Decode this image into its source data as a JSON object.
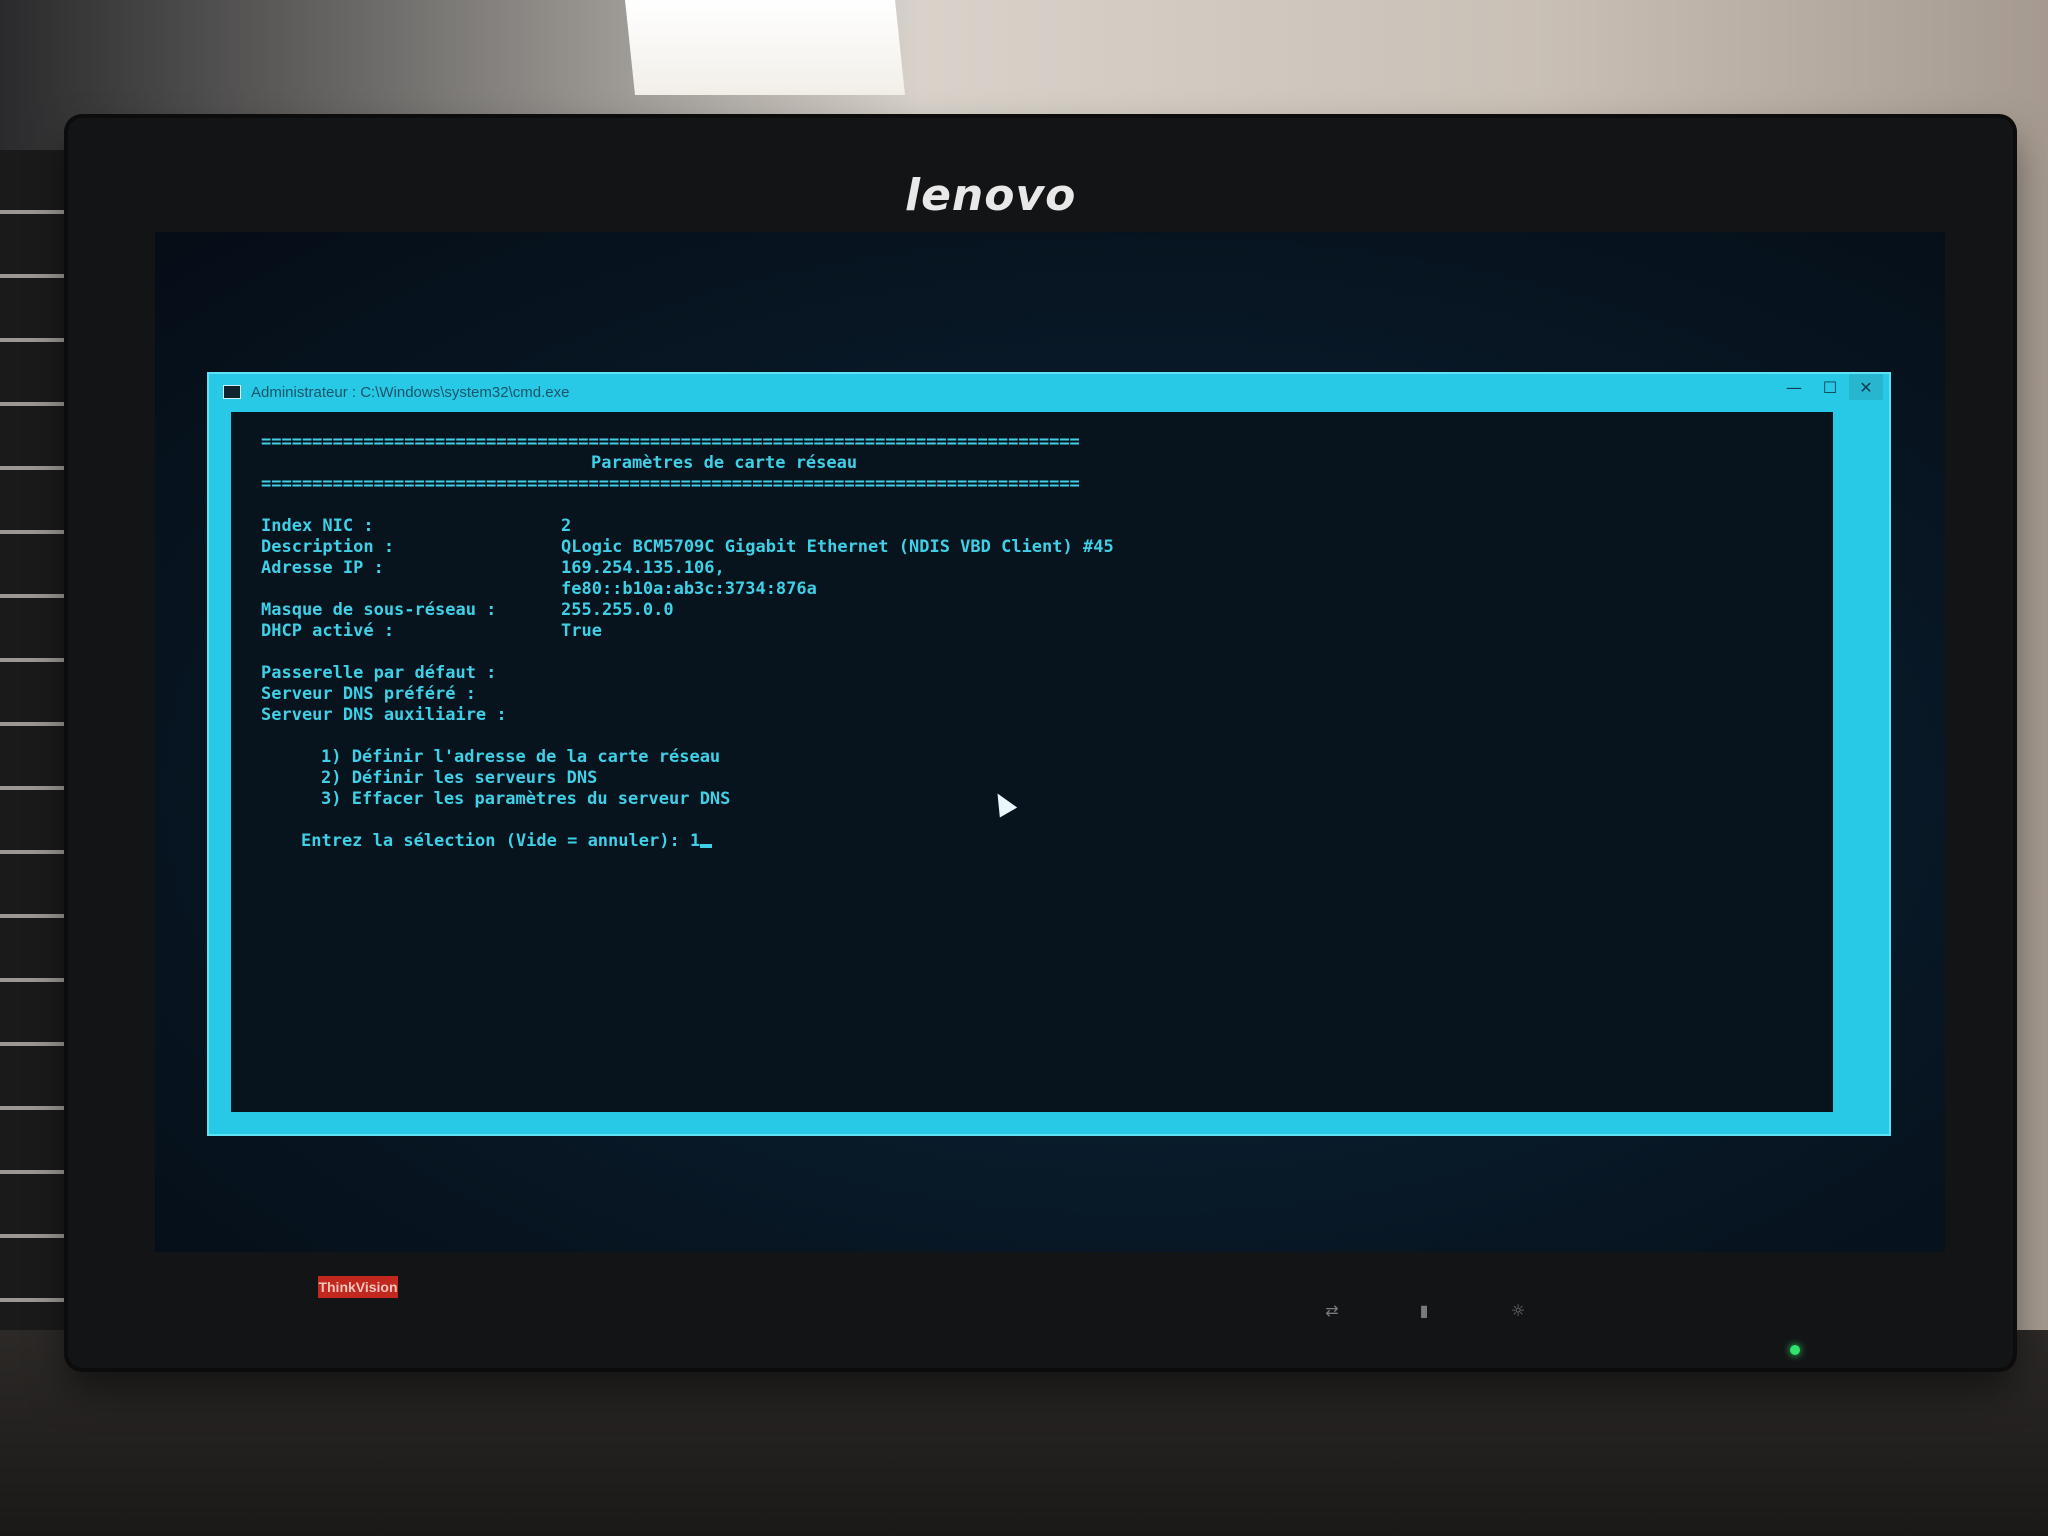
{
  "monitor": {
    "brand": "lenovo",
    "badge": "ThinkVision"
  },
  "window": {
    "title": "Administrateur : C:\\Windows\\system32\\cmd.exe",
    "controls": {
      "minimize": "—",
      "maximize": "☐",
      "close": "✕"
    }
  },
  "console": {
    "rule": "================================================================================",
    "heading": "Paramètres de carte réseau",
    "fields": [
      {
        "label": "Index NIC :",
        "value": "2"
      },
      {
        "label": "Description :",
        "value": "QLogic BCM5709C Gigabit Ethernet (NDIS VBD Client) #45"
      },
      {
        "label": "Adresse IP :",
        "value": "169.254.135.106,"
      },
      {
        "label": "",
        "value": "fe80::b10a:ab3c:3734:876a"
      },
      {
        "label": "Masque de sous-réseau :",
        "value": "255.255.0.0"
      },
      {
        "label": "DHCP activé :",
        "value": "True"
      }
    ],
    "fields2": [
      {
        "label": "Passerelle par défaut :",
        "value": ""
      },
      {
        "label": "Serveur DNS préféré :",
        "value": ""
      },
      {
        "label": "Serveur DNS auxiliaire :",
        "value": ""
      }
    ],
    "menu": [
      "1) Définir l'adresse de la carte réseau",
      "2) Définir les serveurs DNS",
      "3) Effacer les paramètres du serveur DNS"
    ],
    "prompt": "Entrez la sélection (Vide = annuler): ",
    "input": "1"
  }
}
